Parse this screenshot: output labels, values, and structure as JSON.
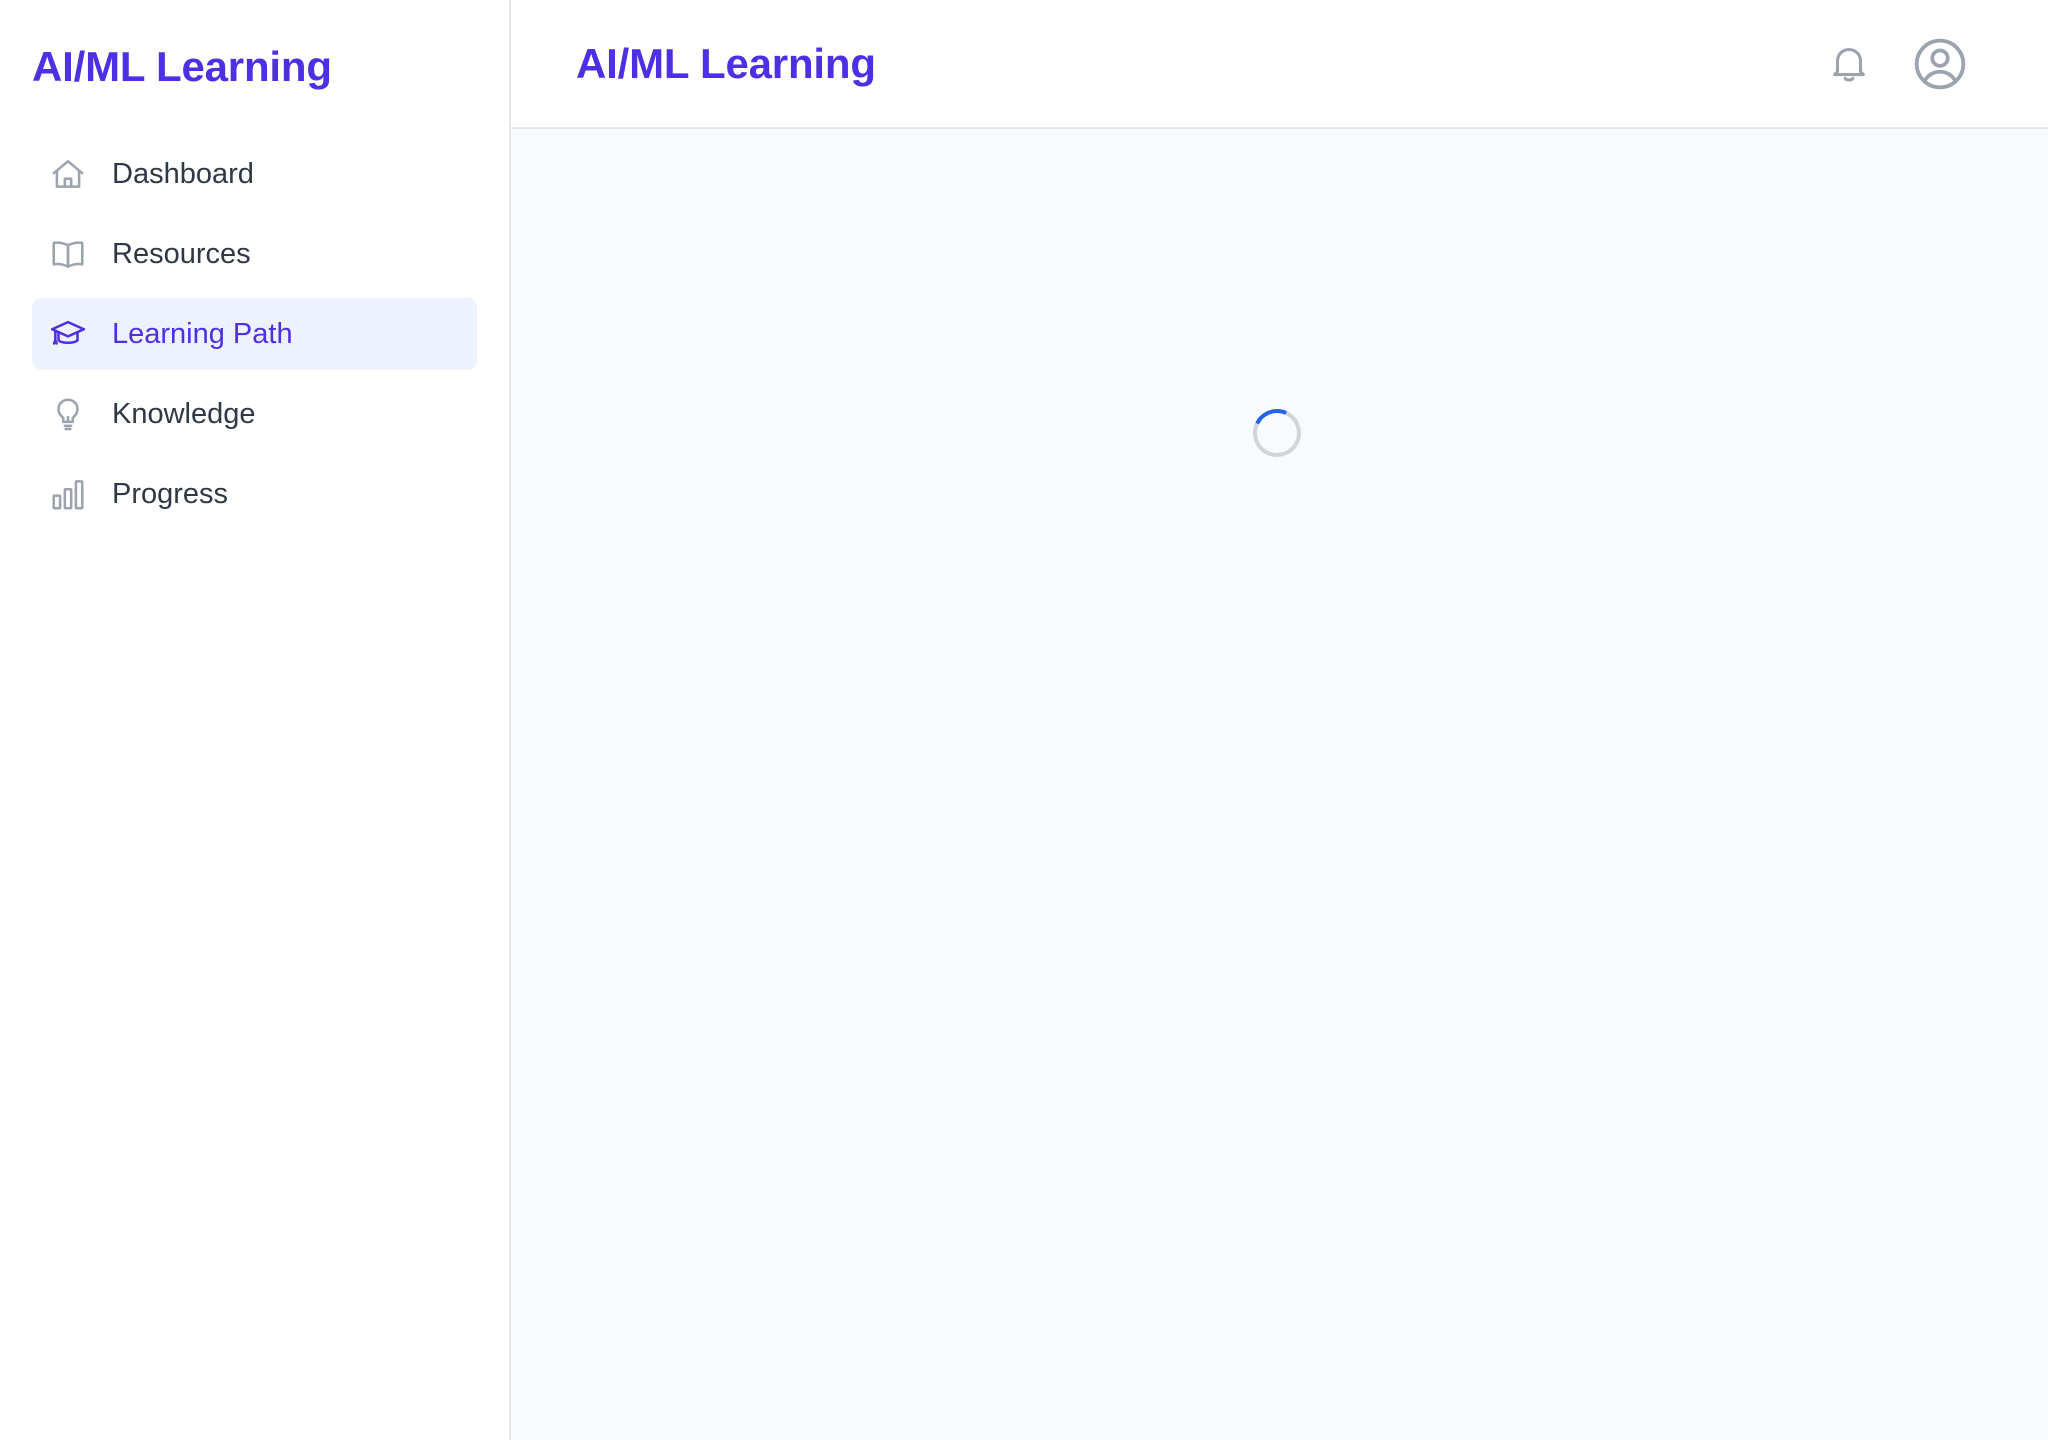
{
  "sidebar": {
    "brand": "AI/ML Learning",
    "items": [
      {
        "label": "Dashboard",
        "icon": "home-icon",
        "active": false
      },
      {
        "label": "Resources",
        "icon": "book-open-icon",
        "active": false
      },
      {
        "label": "Learning Path",
        "icon": "graduation-cap-icon",
        "active": true
      },
      {
        "label": "Knowledge",
        "icon": "lightbulb-icon",
        "active": false
      },
      {
        "label": "Progress",
        "icon": "bar-chart-icon",
        "active": false
      }
    ]
  },
  "header": {
    "title": "AI/ML Learning",
    "notifications_icon": "bell-icon",
    "profile_icon": "user-circle-icon"
  },
  "main": {
    "loading_indicator": "spinner-icon"
  },
  "colors": {
    "accent": "#4f2fe3",
    "active_bg": "#eef2ff",
    "icon_gray": "#9ca3af",
    "text": "#303846",
    "spinner": "#2563eb",
    "content_bg": "#f9fafb"
  }
}
